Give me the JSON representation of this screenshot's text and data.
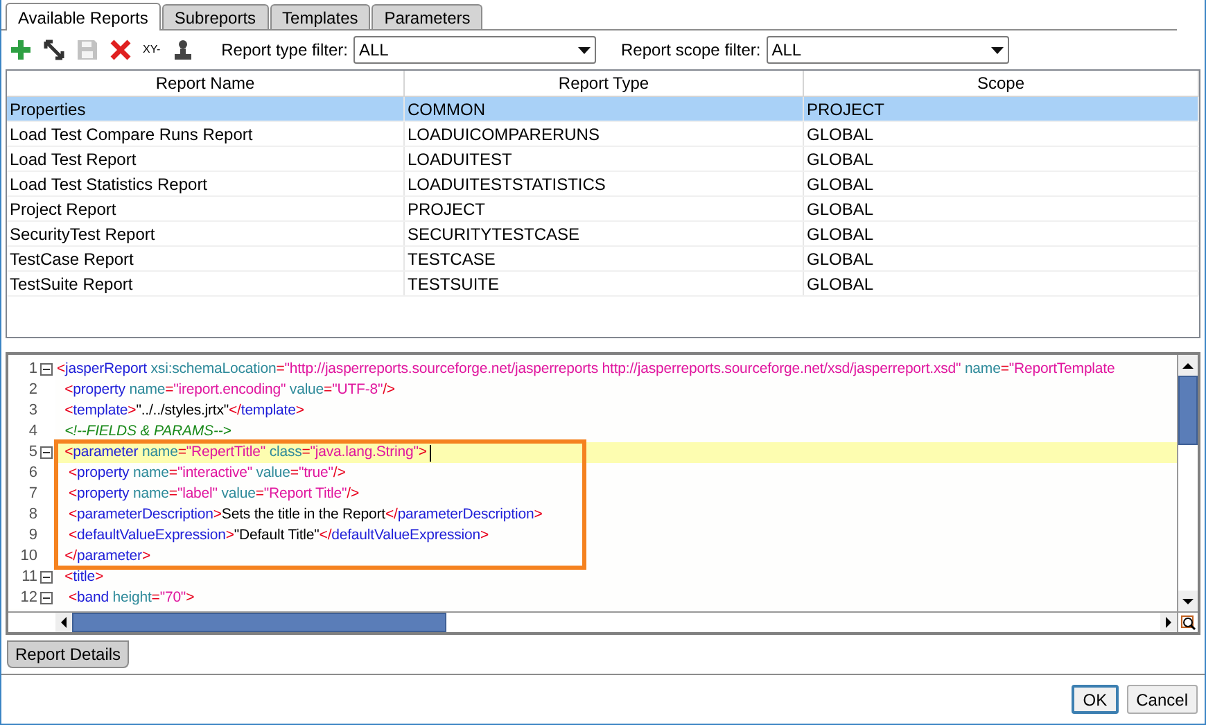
{
  "tabs": [
    {
      "label": "Available Reports",
      "selected": true
    },
    {
      "label": "Subreports",
      "selected": false
    },
    {
      "label": "Templates",
      "selected": false
    },
    {
      "label": "Parameters",
      "selected": false
    }
  ],
  "toolbar": {
    "buttons": [
      {
        "kind": "add"
      },
      {
        "kind": "edit"
      },
      {
        "kind": "save",
        "disabled": true
      },
      {
        "kind": "delete"
      },
      {
        "kind": "xy",
        "label": "XY-"
      },
      {
        "kind": "person"
      }
    ],
    "filters": [
      {
        "label": "Report type filter:",
        "value": "ALL"
      },
      {
        "label": "Report scope filter:",
        "value": "ALL"
      }
    ]
  },
  "table": {
    "columns": [
      "Report Name",
      "Report Type",
      "Scope"
    ],
    "rows": [
      {
        "cells": [
          "Properties",
          "COMMON",
          "PROJECT"
        ],
        "selected": true
      },
      {
        "cells": [
          "Load Test Compare Runs Report",
          "LOADUICOMPARERUNS",
          "GLOBAL"
        ],
        "selected": false
      },
      {
        "cells": [
          "Load Test Report",
          "LOADUITEST",
          "GLOBAL"
        ],
        "selected": false
      },
      {
        "cells": [
          "Load Test Statistics Report",
          "LOADUITESTSTATISTICS",
          "GLOBAL"
        ],
        "selected": false
      },
      {
        "cells": [
          "Project Report",
          "PROJECT",
          "GLOBAL"
        ],
        "selected": false
      },
      {
        "cells": [
          "SecurityTest Report",
          "SECURITYTESTCASE",
          "GLOBAL"
        ],
        "selected": false
      },
      {
        "cells": [
          "TestCase Report",
          "TESTCASE",
          "GLOBAL"
        ],
        "selected": false
      },
      {
        "cells": [
          "TestSuite Report",
          "TESTSUITE",
          "GLOBAL"
        ],
        "selected": false
      }
    ]
  },
  "editor": {
    "lines": [
      {
        "number": "1",
        "foldable": true,
        "highlighted": false,
        "boxed": false,
        "tokens": [
          {
            "kind": "punct",
            "text": "<"
          },
          {
            "kind": "tag",
            "text": "jasperReport"
          },
          {
            "kind": "attr",
            "text": " xsi:schemaLocation"
          },
          {
            "kind": "punct",
            "text": "="
          },
          {
            "kind": "value",
            "text": "\"http://jasperreports.sourceforge.net/jasperreports http://jasperreports.sourceforge.net/xsd/jasperreport.xsd\""
          },
          {
            "kind": "attr",
            "text": " name"
          },
          {
            "kind": "punct",
            "text": "="
          },
          {
            "kind": "value",
            "text": "\"ReportTemplate"
          }
        ]
      },
      {
        "number": "2",
        "foldable": false,
        "highlighted": false,
        "boxed": false,
        "tokens": [
          {
            "kind": "punct",
            "text": "  <"
          },
          {
            "kind": "tag",
            "text": "property"
          },
          {
            "kind": "attr",
            "text": " name"
          },
          {
            "kind": "punct",
            "text": "="
          },
          {
            "kind": "value",
            "text": "\"ireport.encoding\""
          },
          {
            "kind": "attr",
            "text": " value"
          },
          {
            "kind": "punct",
            "text": "="
          },
          {
            "kind": "value",
            "text": "\"UTF-8\""
          },
          {
            "kind": "punct",
            "text": "/>"
          }
        ]
      },
      {
        "number": "3",
        "foldable": false,
        "highlighted": false,
        "boxed": false,
        "tokens": [
          {
            "kind": "punct",
            "text": "  <"
          },
          {
            "kind": "tag",
            "text": "template"
          },
          {
            "kind": "punct",
            "text": ">"
          },
          {
            "kind": "text",
            "text": "\"../../styles.jrtx\""
          },
          {
            "kind": "punct",
            "text": "</"
          },
          {
            "kind": "tag",
            "text": "template"
          },
          {
            "kind": "punct",
            "text": ">"
          }
        ]
      },
      {
        "number": "4",
        "foldable": false,
        "highlighted": false,
        "boxed": false,
        "tokens": [
          {
            "kind": "comment",
            "text": "  <!--FIELDS & PARAMS-->"
          }
        ]
      },
      {
        "number": "5",
        "foldable": true,
        "highlighted": true,
        "boxed": true,
        "tokens": [
          {
            "kind": "punct",
            "text": "  <"
          },
          {
            "kind": "tag",
            "text": "parameter"
          },
          {
            "kind": "attr",
            "text": " name"
          },
          {
            "kind": "punct",
            "text": "="
          },
          {
            "kind": "value",
            "text": "\"RepertTitle\""
          },
          {
            "kind": "attr",
            "text": " class"
          },
          {
            "kind": "punct",
            "text": "="
          },
          {
            "kind": "value",
            "text": "\"java.lang.String\""
          },
          {
            "kind": "punct",
            "text": ">"
          }
        ]
      },
      {
        "number": "6",
        "foldable": false,
        "highlighted": false,
        "boxed": true,
        "tokens": [
          {
            "kind": "punct",
            "text": "   <"
          },
          {
            "kind": "tag",
            "text": "property"
          },
          {
            "kind": "attr",
            "text": " name"
          },
          {
            "kind": "punct",
            "text": "="
          },
          {
            "kind": "value",
            "text": "\"interactive\""
          },
          {
            "kind": "attr",
            "text": " value"
          },
          {
            "kind": "punct",
            "text": "="
          },
          {
            "kind": "value",
            "text": "\"true\""
          },
          {
            "kind": "punct",
            "text": "/>"
          }
        ]
      },
      {
        "number": "7",
        "foldable": false,
        "highlighted": false,
        "boxed": true,
        "tokens": [
          {
            "kind": "punct",
            "text": "   <"
          },
          {
            "kind": "tag",
            "text": "property"
          },
          {
            "kind": "attr",
            "text": " name"
          },
          {
            "kind": "punct",
            "text": "="
          },
          {
            "kind": "value",
            "text": "\"label\""
          },
          {
            "kind": "attr",
            "text": " value"
          },
          {
            "kind": "punct",
            "text": "="
          },
          {
            "kind": "value",
            "text": "\"Report Title\""
          },
          {
            "kind": "punct",
            "text": "/>"
          }
        ]
      },
      {
        "number": "8",
        "foldable": false,
        "highlighted": false,
        "boxed": true,
        "tokens": [
          {
            "kind": "punct",
            "text": "   <"
          },
          {
            "kind": "tag",
            "text": "parameterDescription"
          },
          {
            "kind": "punct",
            "text": ">"
          },
          {
            "kind": "text",
            "text": "Sets the title in the Report"
          },
          {
            "kind": "punct",
            "text": "</"
          },
          {
            "kind": "tag",
            "text": "parameterDescription"
          },
          {
            "kind": "punct",
            "text": ">"
          }
        ]
      },
      {
        "number": "9",
        "foldable": false,
        "highlighted": false,
        "boxed": true,
        "tokens": [
          {
            "kind": "punct",
            "text": "   <"
          },
          {
            "kind": "tag",
            "text": "defaultValueExpression"
          },
          {
            "kind": "punct",
            "text": ">"
          },
          {
            "kind": "text",
            "text": "\"Default Title\""
          },
          {
            "kind": "punct",
            "text": "</"
          },
          {
            "kind": "tag",
            "text": "defaultValueExpression"
          },
          {
            "kind": "punct",
            "text": ">"
          }
        ]
      },
      {
        "number": "10",
        "foldable": false,
        "highlighted": false,
        "boxed": true,
        "tokens": [
          {
            "kind": "punct",
            "text": "  </"
          },
          {
            "kind": "tag",
            "text": "parameter"
          },
          {
            "kind": "punct",
            "text": ">"
          }
        ]
      },
      {
        "number": "11",
        "foldable": true,
        "highlighted": false,
        "boxed": false,
        "tokens": [
          {
            "kind": "punct",
            "text": "  <"
          },
          {
            "kind": "tag",
            "text": "title"
          },
          {
            "kind": "punct",
            "text": ">"
          }
        ]
      },
      {
        "number": "12",
        "foldable": true,
        "highlighted": false,
        "boxed": false,
        "tokens": [
          {
            "kind": "punct",
            "text": "   <"
          },
          {
            "kind": "tag",
            "text": "band"
          },
          {
            "kind": "attr",
            "text": " height"
          },
          {
            "kind": "punct",
            "text": "="
          },
          {
            "kind": "value",
            "text": "\"70\""
          },
          {
            "kind": "punct",
            "text": ">"
          }
        ]
      }
    ]
  },
  "bottom_tab": {
    "label": "Report Details"
  },
  "buttons": [
    {
      "label": "OK",
      "default": true
    },
    {
      "label": "Cancel",
      "default": false
    }
  ]
}
